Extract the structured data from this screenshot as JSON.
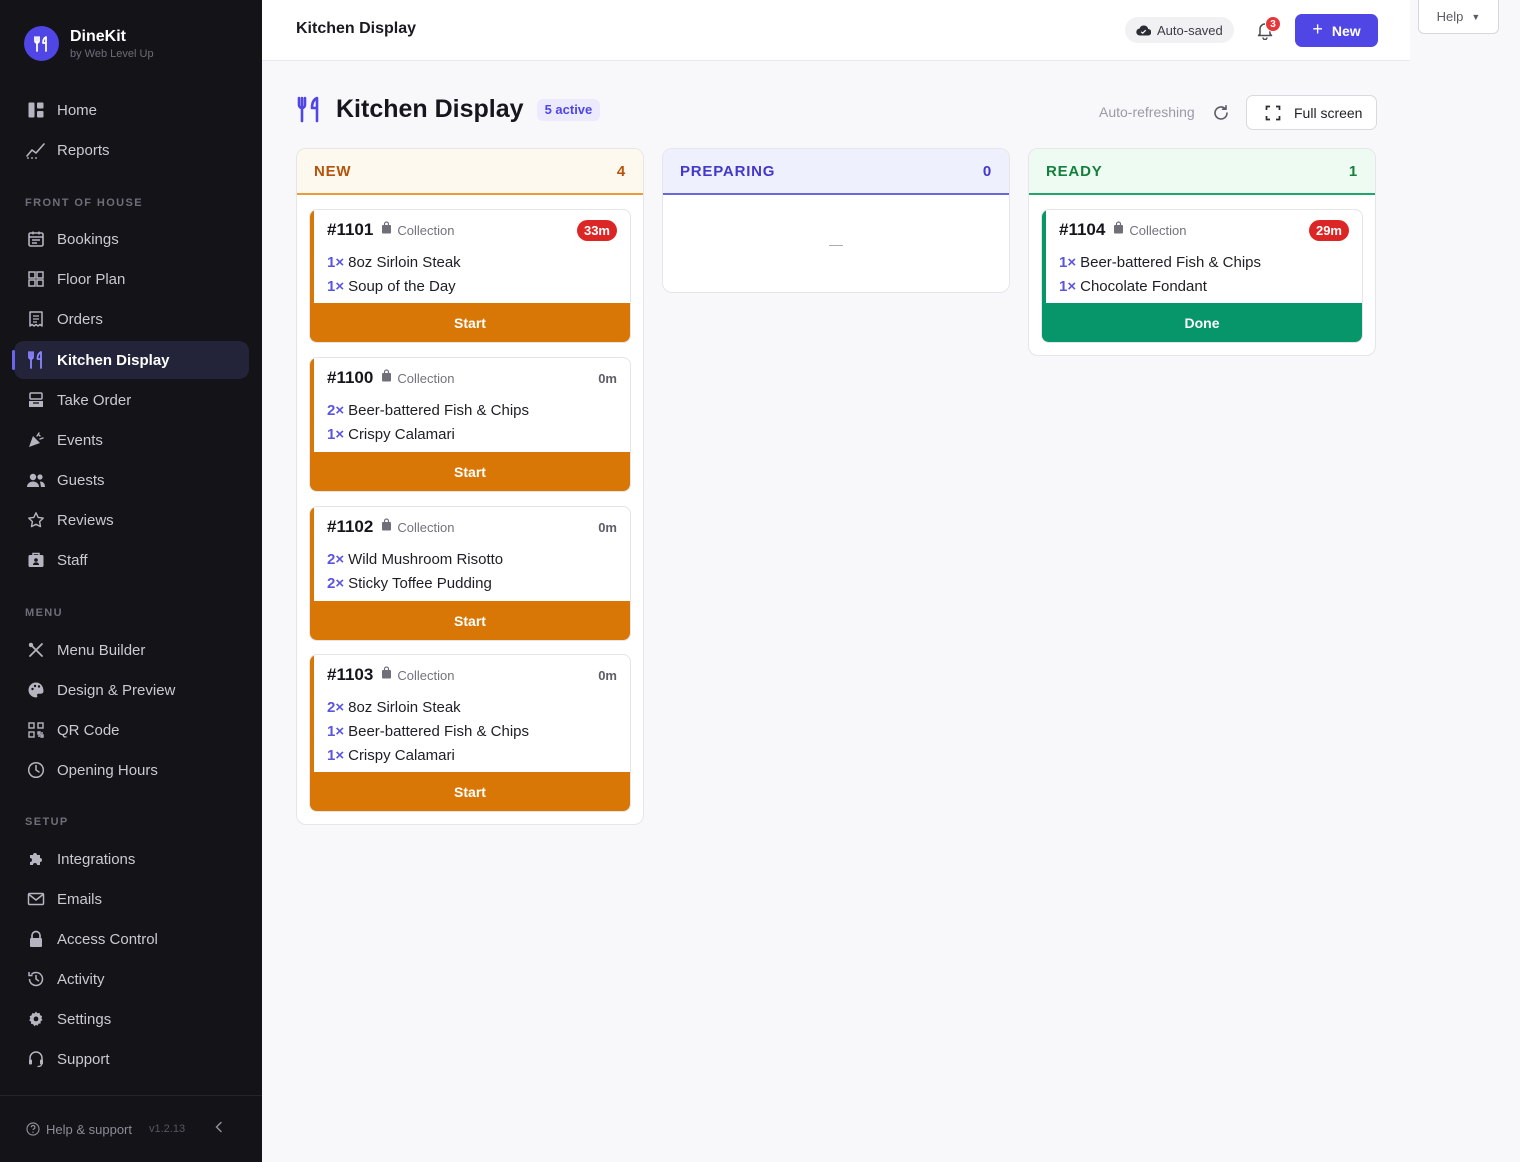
{
  "brand": {
    "name": "DineKit",
    "subtitle": "by Web Level Up"
  },
  "sidebar": {
    "top_items": [
      {
        "label": "Home",
        "icon": "home-icon"
      },
      {
        "label": "Reports",
        "icon": "reports-icon"
      }
    ],
    "sections": [
      {
        "title": "FRONT OF HOUSE",
        "items": [
          {
            "label": "Bookings",
            "icon": "calendar-icon"
          },
          {
            "label": "Floor Plan",
            "icon": "grid-icon"
          },
          {
            "label": "Orders",
            "icon": "receipt-icon"
          },
          {
            "label": "Kitchen Display",
            "icon": "utensils-icon",
            "active": true
          },
          {
            "label": "Take Order",
            "icon": "register-icon"
          },
          {
            "label": "Events",
            "icon": "party-icon"
          },
          {
            "label": "Guests",
            "icon": "users-icon"
          },
          {
            "label": "Reviews",
            "icon": "star-icon"
          },
          {
            "label": "Staff",
            "icon": "briefcase-icon"
          }
        ]
      },
      {
        "title": "MENU",
        "items": [
          {
            "label": "Menu Builder",
            "icon": "cutlery-icon"
          },
          {
            "label": "Design & Preview",
            "icon": "palette-icon"
          },
          {
            "label": "QR Code",
            "icon": "qr-icon"
          },
          {
            "label": "Opening Hours",
            "icon": "clock-icon"
          }
        ]
      },
      {
        "title": "SETUP",
        "items": [
          {
            "label": "Integrations",
            "icon": "puzzle-icon"
          },
          {
            "label": "Emails",
            "icon": "mail-icon"
          },
          {
            "label": "Access Control",
            "icon": "lock-icon"
          },
          {
            "label": "Activity",
            "icon": "history-icon"
          },
          {
            "label": "Settings",
            "icon": "gear-icon"
          },
          {
            "label": "Support",
            "icon": "headset-icon"
          }
        ]
      }
    ],
    "footer": {
      "help_label": "Help & support",
      "version": "v1.2.13"
    }
  },
  "header": {
    "title": "Kitchen Display",
    "autosave_label": "Auto-saved",
    "notification_count": "3",
    "new_button_label": "New",
    "help_label": "Help"
  },
  "page": {
    "title": "Kitchen Display",
    "active_badge": "5 active",
    "auto_refresh_label": "Auto-refreshing",
    "fullscreen_label": "Full screen"
  },
  "columns": {
    "new": {
      "title": "NEW",
      "count": "4",
      "orders": [
        {
          "number": "#1101",
          "type": "Collection",
          "age": "33m",
          "late": true,
          "items": [
            {
              "qty": "1×",
              "name": "8oz Sirloin Steak"
            },
            {
              "qty": "1×",
              "name": "Soup of the Day"
            }
          ],
          "action": "Start"
        },
        {
          "number": "#1100",
          "type": "Collection",
          "age": "0m",
          "late": false,
          "items": [
            {
              "qty": "2×",
              "name": "Beer-battered Fish & Chips"
            },
            {
              "qty": "1×",
              "name": "Crispy Calamari"
            }
          ],
          "action": "Start"
        },
        {
          "number": "#1102",
          "type": "Collection",
          "age": "0m",
          "late": false,
          "items": [
            {
              "qty": "2×",
              "name": "Wild Mushroom Risotto"
            },
            {
              "qty": "2×",
              "name": "Sticky Toffee Pudding"
            }
          ],
          "action": "Start"
        },
        {
          "number": "#1103",
          "type": "Collection",
          "age": "0m",
          "late": false,
          "items": [
            {
              "qty": "2×",
              "name": "8oz Sirloin Steak"
            },
            {
              "qty": "1×",
              "name": "Beer-battered Fish & Chips"
            },
            {
              "qty": "1×",
              "name": "Crispy Calamari"
            }
          ],
          "action": "Start"
        }
      ]
    },
    "preparing": {
      "title": "PREPARING",
      "count": "0",
      "empty_text": "—"
    },
    "ready": {
      "title": "READY",
      "count": "1",
      "orders": [
        {
          "number": "#1104",
          "type": "Collection",
          "age": "29m",
          "late": true,
          "items": [
            {
              "qty": "1×",
              "name": "Beer-battered Fish & Chips"
            },
            {
              "qty": "1×",
              "name": "Chocolate Fondant"
            }
          ],
          "action": "Done"
        }
      ]
    }
  },
  "colors": {
    "accent": "#4f46e5",
    "start": "#d97706",
    "done": "#079669",
    "late": "#dc2626",
    "sidebar_bg": "#131318"
  }
}
